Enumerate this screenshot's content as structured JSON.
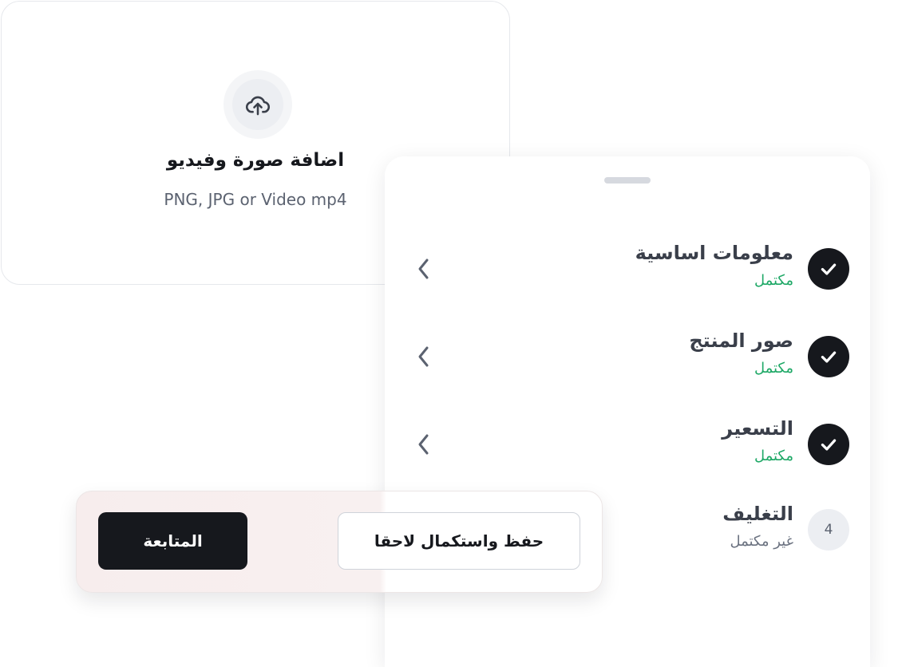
{
  "upload": {
    "icon": "cloud-upload-icon",
    "title": "اضافة صورة وفيديو",
    "formats": "PNG, JPG or Video mp4"
  },
  "steps": [
    {
      "title": "معلومات اساسية",
      "status": "مكتمل",
      "state": "complete",
      "icon": "checkmark-icon"
    },
    {
      "title": "صور المنتج",
      "status": "مكتمل",
      "state": "complete",
      "icon": "checkmark-icon"
    },
    {
      "title": "التسعير",
      "status": "مكتمل",
      "state": "complete",
      "icon": "checkmark-icon"
    },
    {
      "title": "التغليف",
      "status": "غير مكتمل",
      "state": "incomplete",
      "number": "4"
    }
  ],
  "actions": {
    "continue_label": "المتابعة",
    "save_later_label": "حفظ واستكمال لاحقا"
  },
  "colors": {
    "dark": "#16181d",
    "complete_green": "#1ea866",
    "muted_gray": "#6b7280",
    "chevron": "#5b6270"
  }
}
